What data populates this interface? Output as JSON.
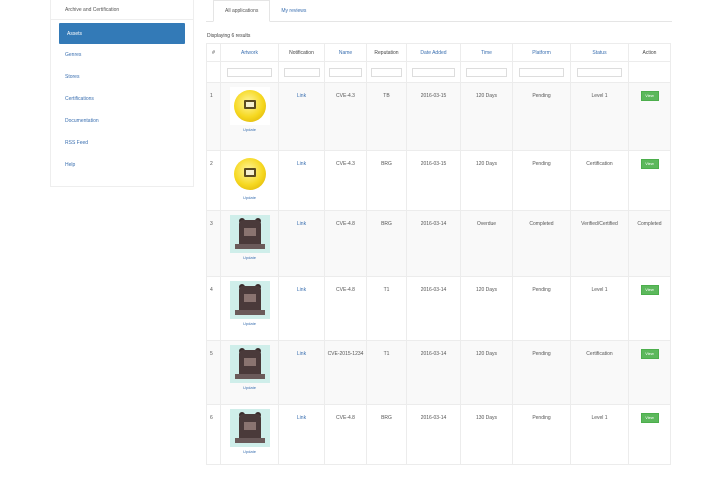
{
  "sidebar": {
    "header": "Archive and Certification",
    "items": [
      "Assets",
      "Genres",
      "Stores",
      "Certifications",
      "Documentation",
      "RSS Feed",
      "Help"
    ]
  },
  "tabs": [
    "All applications",
    "My reviews"
  ],
  "results_count": "Displaying 6 results",
  "table": {
    "headers": [
      "#",
      "Artwork",
      "Notification",
      "Name",
      "Reputation",
      "Date Added",
      "Time",
      "Platform",
      "Status",
      "Action"
    ],
    "rows": [
      {
        "num": "1",
        "icon": "yellow",
        "caption": "Update",
        "notif": "Link",
        "name": "CVE-4.3",
        "rep": "TB",
        "date": "2016-03-15",
        "time": "120 Days",
        "platform": "Pending",
        "status": "Level 1",
        "action": "View"
      },
      {
        "num": "2",
        "icon": "yellow",
        "caption": "Update",
        "notif": "Link",
        "name": "CVE-4.3",
        "rep": "BRG",
        "date": "2016-03-15",
        "time": "120 Days",
        "platform": "Pending",
        "status": "Certification",
        "action": "View"
      },
      {
        "num": "3",
        "icon": "bear",
        "caption": "Update",
        "notif": "Link",
        "name": "CVE-4.8",
        "rep": "BRG",
        "date": "2016-03-14",
        "time": "Overdue",
        "platform": "Completed",
        "status": "Verified/Certified",
        "action": "Completed"
      },
      {
        "num": "4",
        "icon": "bear",
        "caption": "Update",
        "notif": "Link",
        "name": "CVE-4.8",
        "rep": "T1",
        "date": "2016-03-14",
        "time": "120 Days",
        "platform": "Pending",
        "status": "Level 1",
        "action": "View"
      },
      {
        "num": "5",
        "icon": "bear",
        "caption": "Update",
        "notif": "Link",
        "name": "CVE-2015-1234",
        "rep": "T1",
        "date": "2016-03-14",
        "time": "120 Days",
        "platform": "Pending",
        "status": "Certification",
        "action": "View"
      },
      {
        "num": "6",
        "icon": "bear",
        "caption": "Update",
        "notif": "Link",
        "name": "CVE-4.8",
        "rep": "BRG",
        "date": "2016-03-14",
        "time": "130 Days",
        "platform": "Pending",
        "status": "Level 1",
        "action": "View"
      }
    ]
  }
}
